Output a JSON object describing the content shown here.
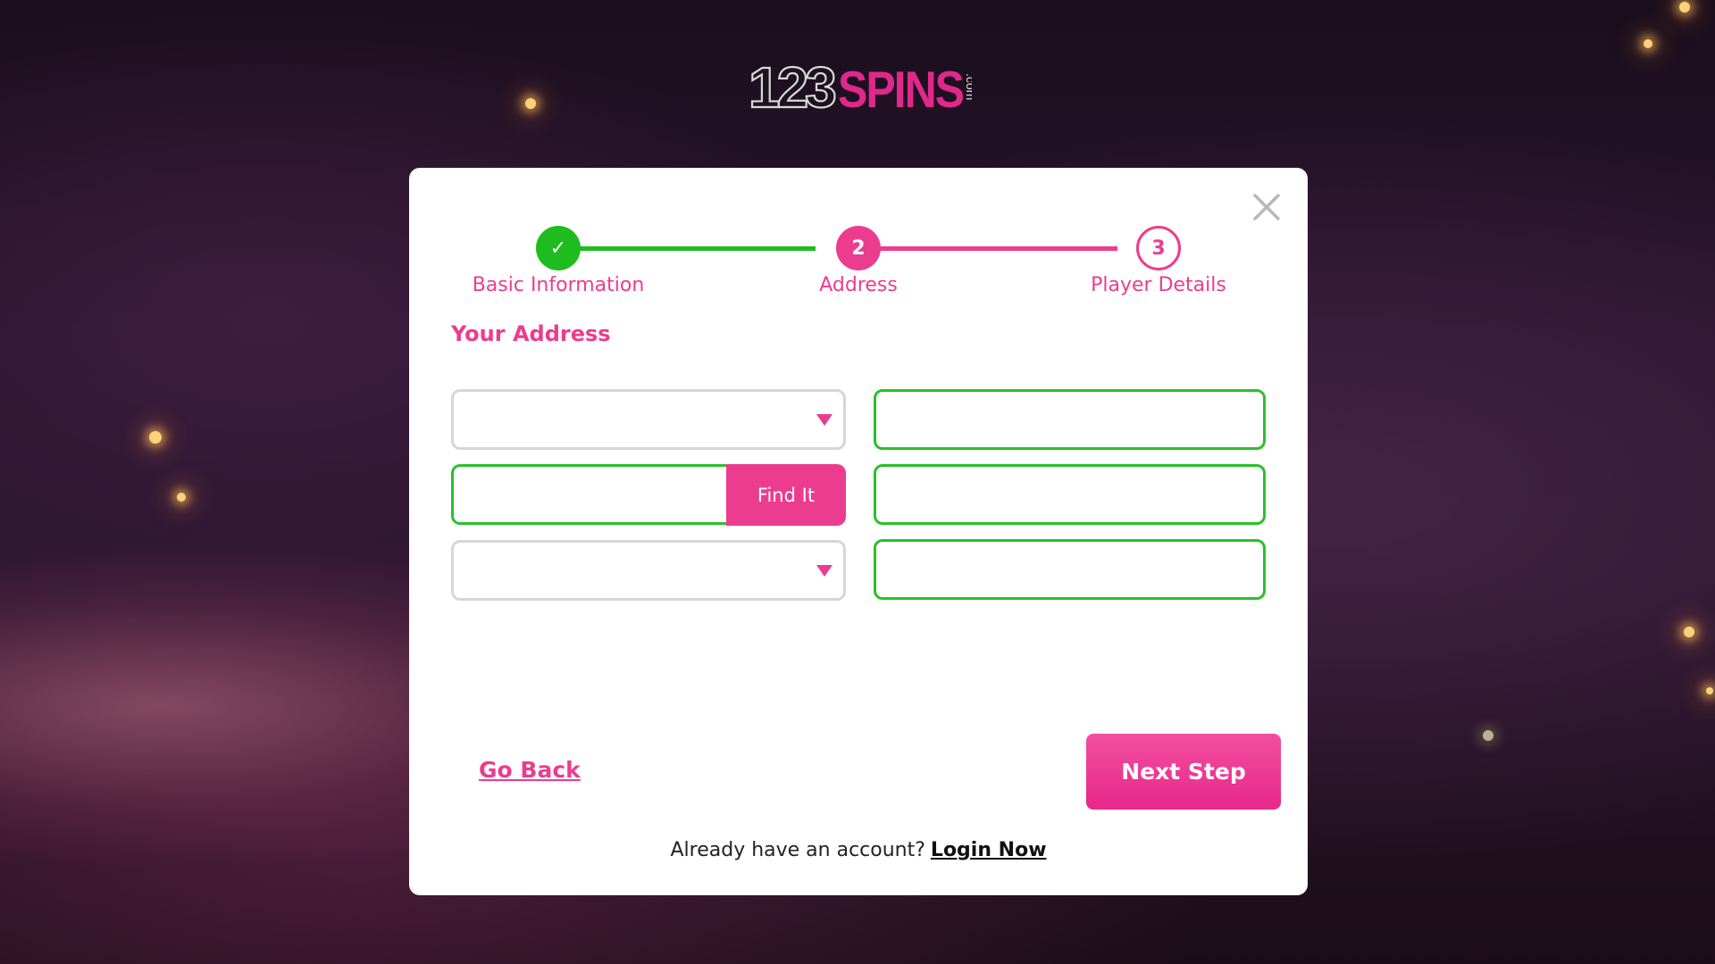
{
  "brand": {
    "logo_text_numbers": "123",
    "logo_text_word": "SPINS",
    "logo_text_suffix": ".com"
  },
  "colors": {
    "accent": "#ec3c8f",
    "success": "#1fbc1f",
    "field_valid_border": "#2ac02a",
    "field_default_border": "#d6d6d6"
  },
  "close_icon": "close-icon",
  "stepper": {
    "steps": [
      {
        "label": "Basic Information",
        "marker": "✓",
        "state": "done"
      },
      {
        "label": "Address",
        "marker": "2",
        "state": "active"
      },
      {
        "label": "Player Details",
        "marker": "3",
        "state": "todo"
      }
    ]
  },
  "form": {
    "section_title": "Your Address",
    "country_select": {
      "value": ""
    },
    "postcode_input": {
      "value": "",
      "placeholder": ""
    },
    "find_button_label": "Find It",
    "address_select": {
      "value": ""
    },
    "right_field_1": {
      "value": ""
    },
    "right_field_2": {
      "value": ""
    },
    "right_field_3": {
      "value": ""
    }
  },
  "actions": {
    "go_back_label": "Go Back",
    "next_step_label": "Next Step",
    "account_prompt": "Already have an account?",
    "login_label": "Login Now"
  }
}
